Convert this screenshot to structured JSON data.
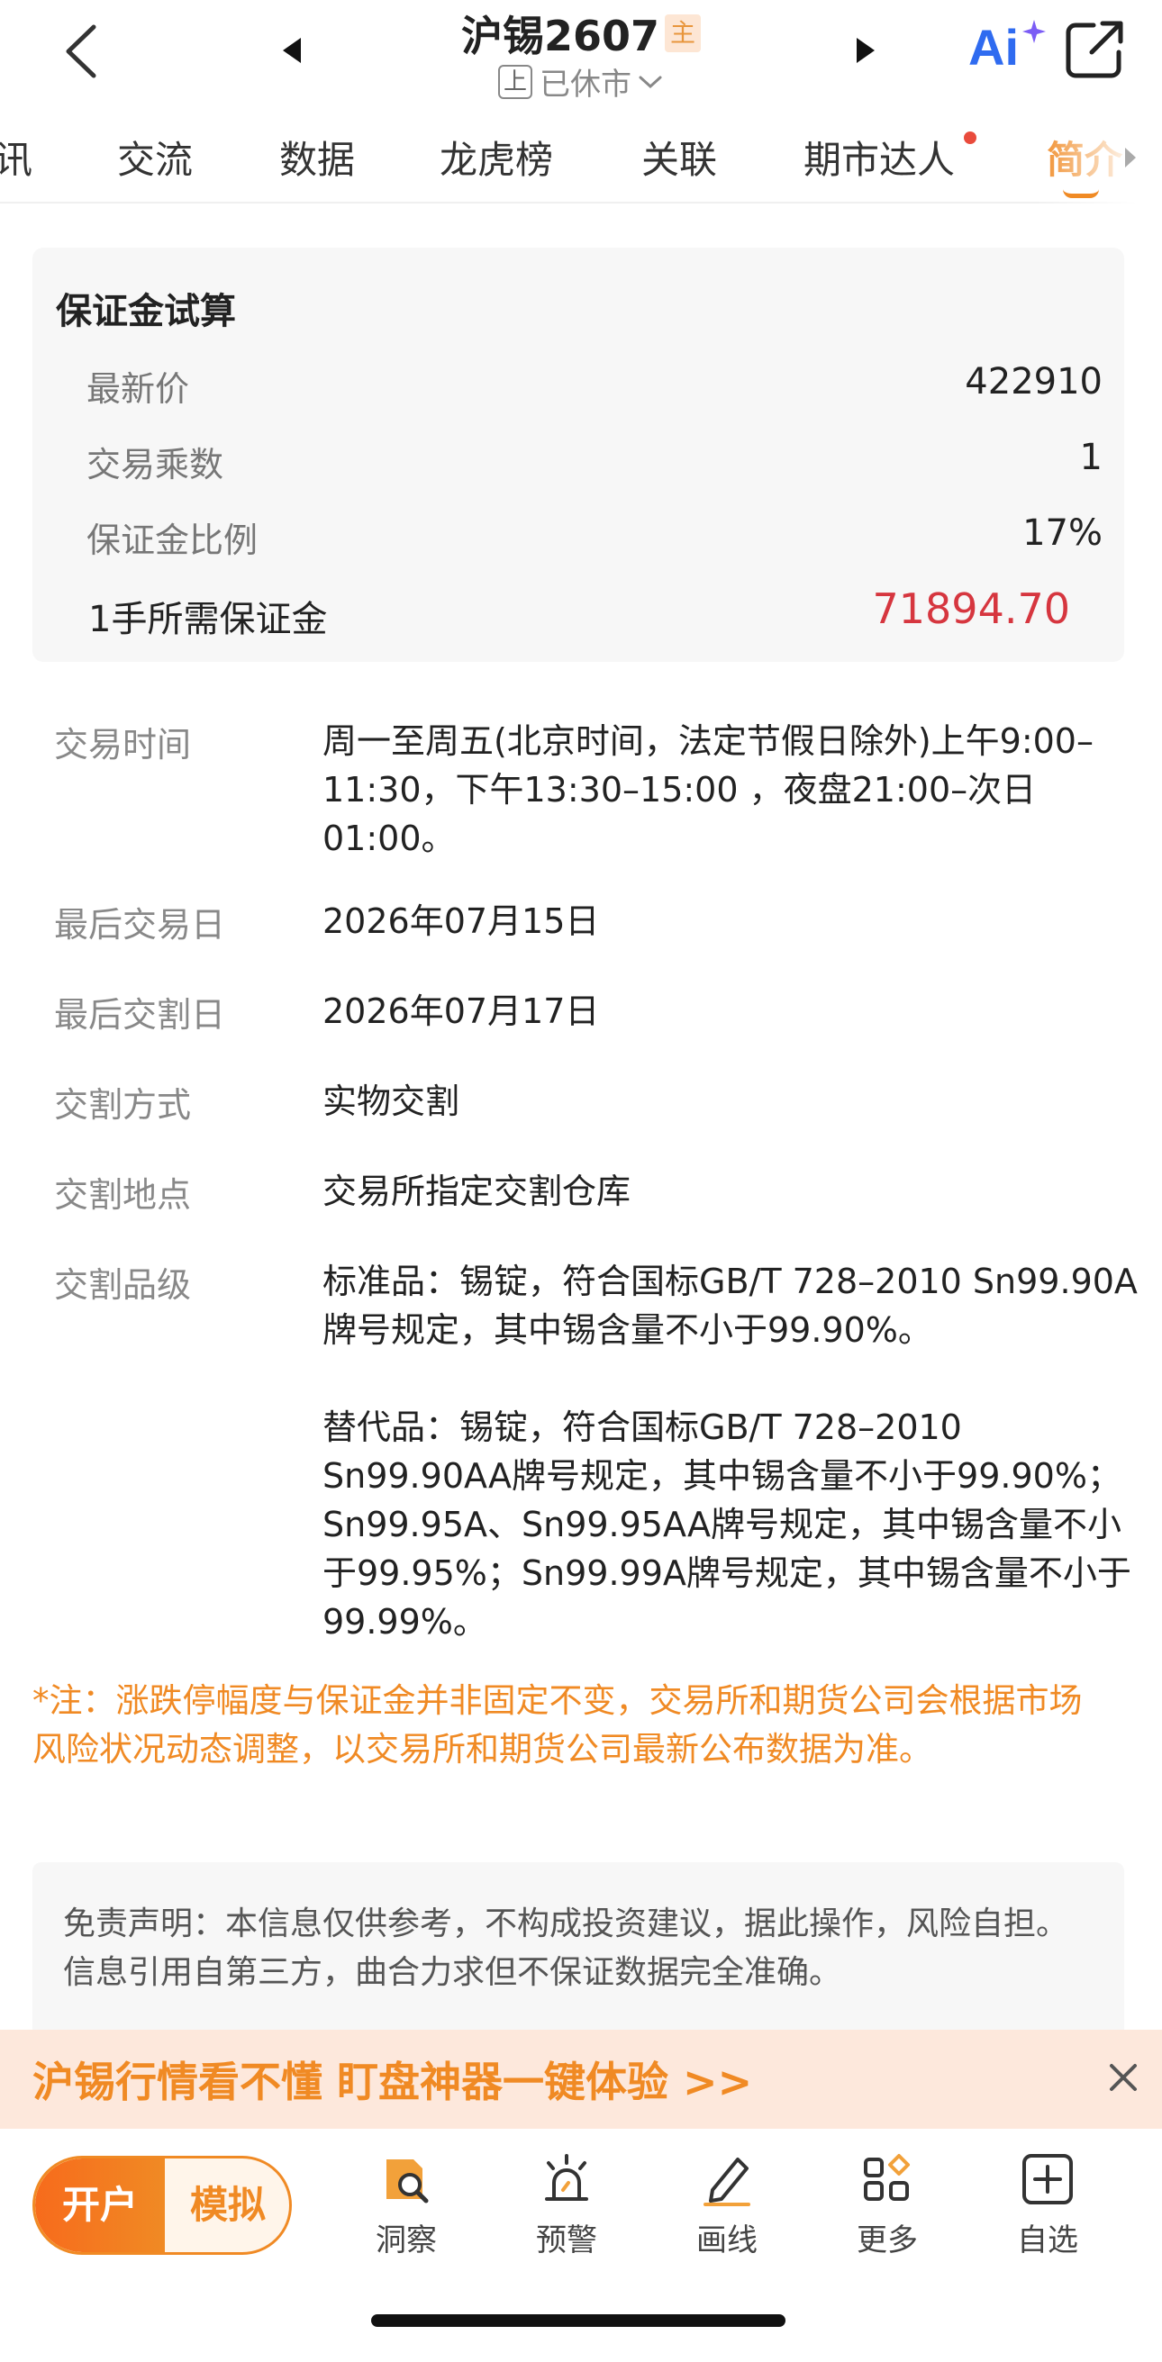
{
  "header": {
    "title": "沪锡2607",
    "main_tag": "主",
    "exchange_badge": "上",
    "status": "已休市",
    "ai_label": "Ai"
  },
  "tabs": [
    {
      "label": "讯"
    },
    {
      "label": "交流"
    },
    {
      "label": "数据"
    },
    {
      "label": "龙虎榜"
    },
    {
      "label": "关联"
    },
    {
      "label": "期市达人"
    },
    {
      "label": "简介",
      "active": true
    }
  ],
  "margin_calc": {
    "title": "保证金试算",
    "rows": [
      {
        "label": "最新价",
        "value": "422910"
      },
      {
        "label": "交易乘数",
        "value": "1"
      },
      {
        "label": "保证金比例",
        "value": "17%"
      }
    ],
    "total_label": "1手所需保证金",
    "total_value": "71894.70"
  },
  "details": [
    {
      "label": "交易时间",
      "value": [
        "周一至周五(北京时间，法定节假日除外)上午9:00–11:30，下午13:30–15:00 ，夜盘21:00–次日01:00。"
      ]
    },
    {
      "label": "最后交易日",
      "value": [
        "2026年07月15日"
      ]
    },
    {
      "label": "最后交割日",
      "value": [
        "2026年07月17日"
      ]
    },
    {
      "label": "交割方式",
      "value": [
        "实物交割"
      ]
    },
    {
      "label": "交割地点",
      "value": [
        "交易所指定交割仓库"
      ]
    },
    {
      "label": "交割品级",
      "value": [
        "标准品：锡锭，符合国标GB/T 728–2010 Sn99.90A牌号规定，其中锡含量不小于99.90%。",
        "替代品：锡锭，符合国标GB/T 728–2010 Sn99.90AA牌号规定，其中锡含量不小于99.90%；Sn99.95A、Sn99.95AA牌号规定，其中锡含量不小于99.95%；Sn99.99A牌号规定，其中锡含量不小于99.99%。"
      ]
    }
  ],
  "note": "*注：涨跌停幅度与保证金并非固定不变，交易所和期货公司会根据市场风险状况动态调整，以交易所和期货公司最新公布数据为准。",
  "disclaimer": "免责声明：本信息仅供参考，不构成投资建议，据此操作，风险自担。信息引用自第三方，曲合力求但不保证数据完全准确。",
  "promo": {
    "text": "沪锡行情看不懂  盯盘神器一键体验 >>"
  },
  "bottom_bar": {
    "open_label": "开户",
    "sim_label": "模拟",
    "items": [
      {
        "label": "洞察",
        "icon": "insight-icon"
      },
      {
        "label": "预警",
        "icon": "alarm-icon"
      },
      {
        "label": "画线",
        "icon": "pencil-icon"
      },
      {
        "label": "更多",
        "icon": "grid-icon"
      },
      {
        "label": "自选",
        "icon": "add-watchlist-icon"
      }
    ]
  },
  "colors": {
    "accent": "#f08a24",
    "price_red": "#d6363f",
    "ai_blue": "#2f6bf0"
  }
}
